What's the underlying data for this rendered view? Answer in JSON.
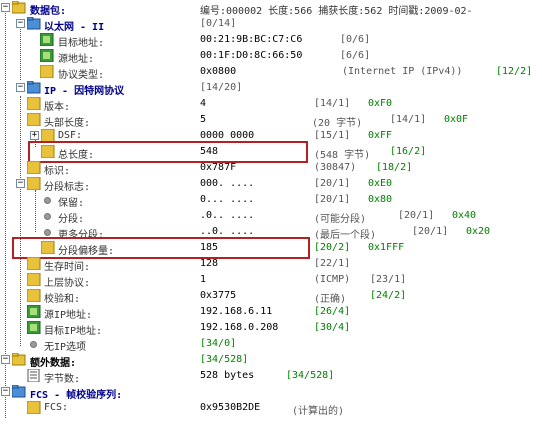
{
  "packet": {
    "label": "数据包:",
    "summary": "编号:000002 长度:566 捕获长度:562 时间戳:2009-02-"
  },
  "ethernet": {
    "label": "以太网 - II",
    "offset": "[0/14]",
    "fields": [
      {
        "label": "目标地址:",
        "value": "00:21:9B:BC:C7:C6",
        "o1": "[0/6]",
        "o2": ""
      },
      {
        "label": "源地址:",
        "value": "00:1F:D0:8C:66:50",
        "o1": "[6/6]",
        "o2": ""
      },
      {
        "label": "协议类型:",
        "value": "0x0800",
        "info": "(Internet IP (IPv4))",
        "o1": "[12/2]"
      }
    ]
  },
  "ip": {
    "label": "IP - 因特网协议",
    "offset": "[14/20]",
    "version": {
      "label": "版本:",
      "value": "4",
      "o1": "[14/1]",
      "o2": "0xF0"
    },
    "header_len": {
      "label": "头部长度:",
      "value": "5",
      "info": "(20 字节)",
      "o1": "[14/1]",
      "o2": "0x0F"
    },
    "dsf": {
      "label": "DSF:",
      "value": "0000 0000",
      "o1": "[15/1]",
      "o2": "0xFF"
    },
    "total_len": {
      "label": "总长度:",
      "value": "548",
      "info": "(548 字节)",
      "o1": "[16/2]"
    },
    "ident": {
      "label": "标识:",
      "value": "0x787F",
      "info": "(30847)",
      "o1": "[18/2]"
    },
    "flags": {
      "label": "分段标志:",
      "value": "000. ....",
      "o1": "[20/1]",
      "o2": "0xE0"
    },
    "flag_reserved": {
      "label": "保留:",
      "value": "0... ....",
      "o1": "[20/1]",
      "o2": "0x80"
    },
    "flag_df": {
      "label": "分段:",
      "value": ".0.. ....",
      "info": "(可能分段)",
      "o1": "[20/1]",
      "o2": "0x40"
    },
    "flag_mf": {
      "label": "更多分段:",
      "value": "..0. ....",
      "info": "(最后一个段)",
      "o1": "[20/1]",
      "o2": "0x20"
    },
    "frag_offset": {
      "label": "分段偏移量:",
      "value": "185",
      "o1": "[20/2]",
      "o2": "0x1FFF"
    },
    "ttl": {
      "label": "生存时间:",
      "value": "128",
      "o1": "[22/1]"
    },
    "protocol": {
      "label": "上层协议:",
      "value": "1",
      "info": "(ICMP)",
      "o1": "[23/1]"
    },
    "checksum": {
      "label": "校验和:",
      "value": "0x3775",
      "info": "(正确)",
      "o1": "[24/2]"
    },
    "src": {
      "label": "源IP地址:",
      "value": "192.168.6.11",
      "o1": "[26/4]"
    },
    "dst": {
      "label": "目标IP地址:",
      "value": "192.168.0.208",
      "o1": "[30/4]"
    },
    "options": {
      "label": "无IP选项",
      "o1": "[34/0]"
    }
  },
  "extra": {
    "label": "额外数据:",
    "offset": "[34/528]",
    "bytes_label": "字节数:",
    "bytes_value": "528 bytes",
    "bytes_offset": "[34/528]"
  },
  "fcs": {
    "label": "FCS - 帧校验序列:",
    "field_label": "FCS:",
    "value": "0x9530B2DE",
    "info": "(计算出的)"
  },
  "colors": {
    "highlight": "#b22222",
    "tree_blue": "#00008b",
    "offset_green": "#008000"
  }
}
